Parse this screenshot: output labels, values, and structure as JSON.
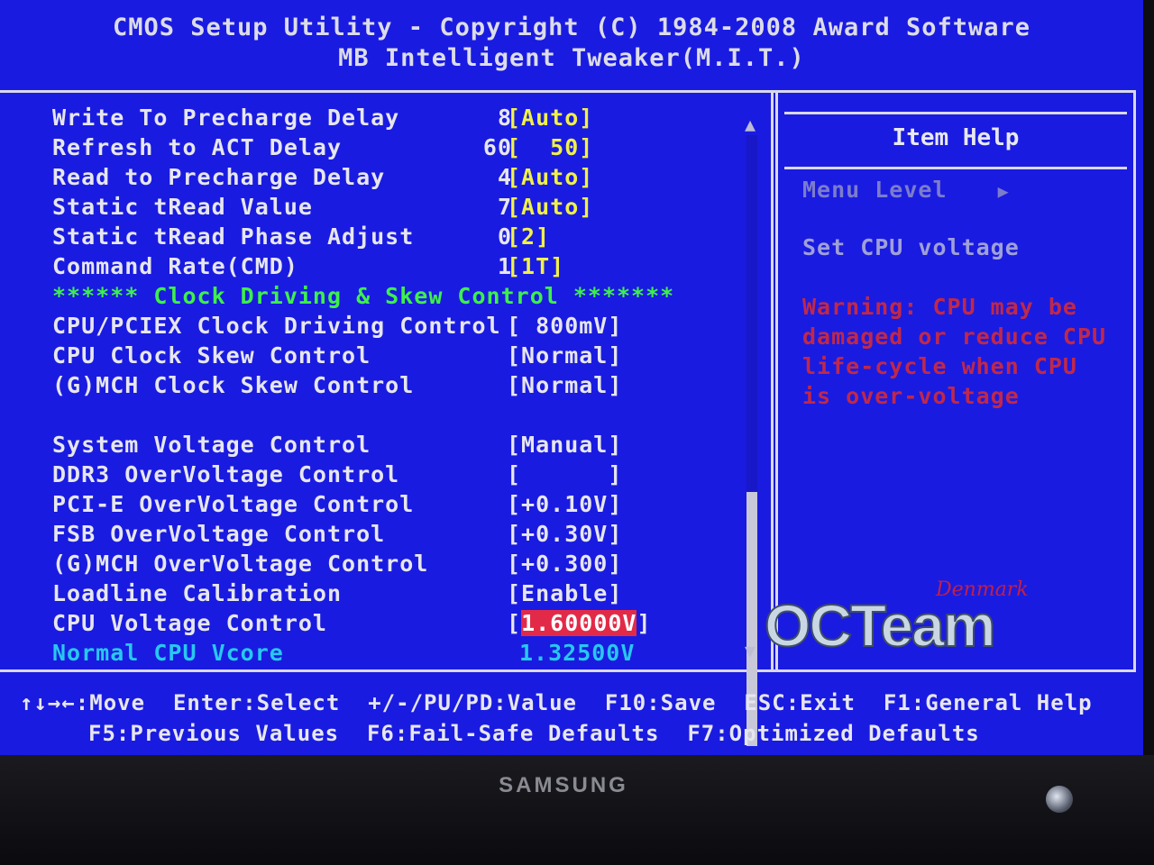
{
  "header": {
    "line1": "CMOS Setup Utility - Copyright (C) 1984-2008 Award Software",
    "line2": "MB Intelligent Tweaker(M.I.T.)"
  },
  "rows": [
    {
      "label": "Write To Precharge Delay",
      "num": "8",
      "value": "[Auto]"
    },
    {
      "label": "Refresh to ACT Delay",
      "num": "60",
      "value": "[  50]"
    },
    {
      "label": "Read to Precharge Delay",
      "num": "4",
      "value": "[Auto]"
    },
    {
      "label": "Static tRead Value",
      "num": "7",
      "value": "[Auto]"
    },
    {
      "label": "Static tRead Phase Adjust",
      "num": "0",
      "value": "[2]"
    },
    {
      "label": "Command Rate(CMD)",
      "num": "1",
      "value": "[1T]"
    },
    {
      "label": "****** Clock Driving & Skew Control *******"
    },
    {
      "label": "CPU/PCIEX Clock Driving Control",
      "value": "[ 800mV]"
    },
    {
      "label": "CPU Clock Skew Control",
      "value": "[Normal]"
    },
    {
      "label": "(G)MCH Clock Skew Control",
      "value": "[Normal]"
    },
    {
      "label": "",
      "value": ""
    },
    {
      "label": "System Voltage Control",
      "value": "[Manual]"
    },
    {
      "label": "DDR3 OverVoltage Control",
      "value": "[      ]"
    },
    {
      "label": "PCI-E OverVoltage Control",
      "value": "[+0.10V]"
    },
    {
      "label": "FSB OverVoltage Control",
      "value": "[+0.30V]"
    },
    {
      "label": "(G)MCH OverVoltage Control",
      "value": "[+0.300]"
    },
    {
      "label": "Loadline Calibration",
      "value": "[Enable]"
    },
    {
      "label": "CPU Voltage Control",
      "value_open": "[",
      "value": "1.60000V",
      "value_close": "]"
    },
    {
      "label": "Normal CPU Vcore",
      "value": "1.32500V"
    }
  ],
  "help": {
    "title": "Item Help",
    "menu_level": "Menu Level",
    "menu_level_arrow": "▶",
    "description": "Set CPU voltage",
    "warning": "Warning: CPU may be\ndamaged or reduce CPU\nlife-cycle  when CPU\nis over-voltage"
  },
  "logo": {
    "main": "OCTeam",
    "sub": "Denmark"
  },
  "footer": {
    "line1": "↑↓→←:Move  Enter:Select  +/-/PU/PD:Value  F10:Save  ESC:Exit  F1:General Help",
    "line2": "F5:Previous Values  F6:Fail-Safe Defaults  F7:Optimized Defaults"
  },
  "scrollbar": {
    "up": "▲",
    "down": "▼"
  },
  "monitor": {
    "brand": "SAMSUNG"
  },
  "colors": {
    "background": "#1a1be0",
    "value_yellow": "#f0f04a",
    "section_green": "#3ef04a",
    "highlight_red": "#e22a48",
    "info_cyan": "#27c8f0",
    "warning_red": "#c0284a"
  }
}
